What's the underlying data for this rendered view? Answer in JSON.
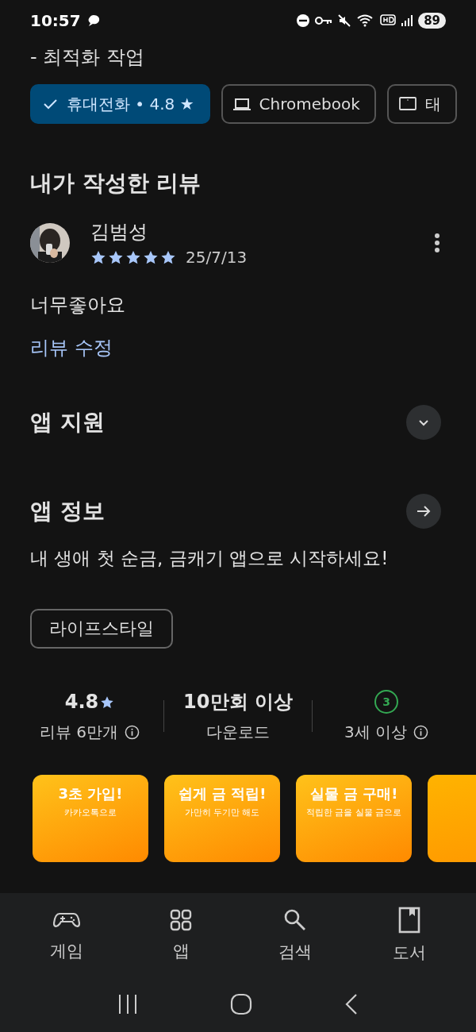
{
  "status_bar": {
    "time": "10:57",
    "battery": "89"
  },
  "intro_line": "- 최적화 작업",
  "device_chips": [
    {
      "kind": "phone",
      "label": "휴대전화 • 4.8 ★",
      "selected": true
    },
    {
      "kind": "laptop",
      "label": "Chromebook",
      "selected": false
    },
    {
      "kind": "tablet",
      "label": "태",
      "selected": false
    }
  ],
  "my_review": {
    "heading": "내가 작성한 리뷰",
    "author": "김범성",
    "stars": 5,
    "date": "25/7/13",
    "text": "너무좋아요",
    "edit_link": "리뷰 수정"
  },
  "sections": [
    {
      "kind": "expand",
      "title": "앱 지원"
    },
    {
      "kind": "arrow",
      "title": "앱 정보"
    }
  ],
  "description": "내 생애 첫 순금, 금캐기 앱으로 시작하세요!",
  "category_tag": "라이프스타일",
  "stats": [
    {
      "kind": "rating",
      "value": "4.8",
      "caption": "리뷰 6만개"
    },
    {
      "kind": "plain",
      "value": "10만회 이상",
      "caption": "다운로드"
    },
    {
      "kind": "age",
      "value": "3",
      "caption": "3세 이상"
    }
  ],
  "screenshots": [
    {
      "title": "3초 가입!",
      "subtitle": "카카오톡으로"
    },
    {
      "title": "쉽게 금 적립!",
      "subtitle": "가만히 두기만 해도"
    },
    {
      "title": "실물 금 구매!",
      "subtitle": "적립한 금을 실물 금으로"
    },
    {
      "kind": "partial"
    }
  ],
  "bottom_nav": [
    {
      "kind": "games",
      "label": "게임"
    },
    {
      "kind": "apps",
      "label": "앱"
    },
    {
      "kind": "search",
      "label": "검색"
    },
    {
      "kind": "books",
      "label": "도서"
    }
  ]
}
